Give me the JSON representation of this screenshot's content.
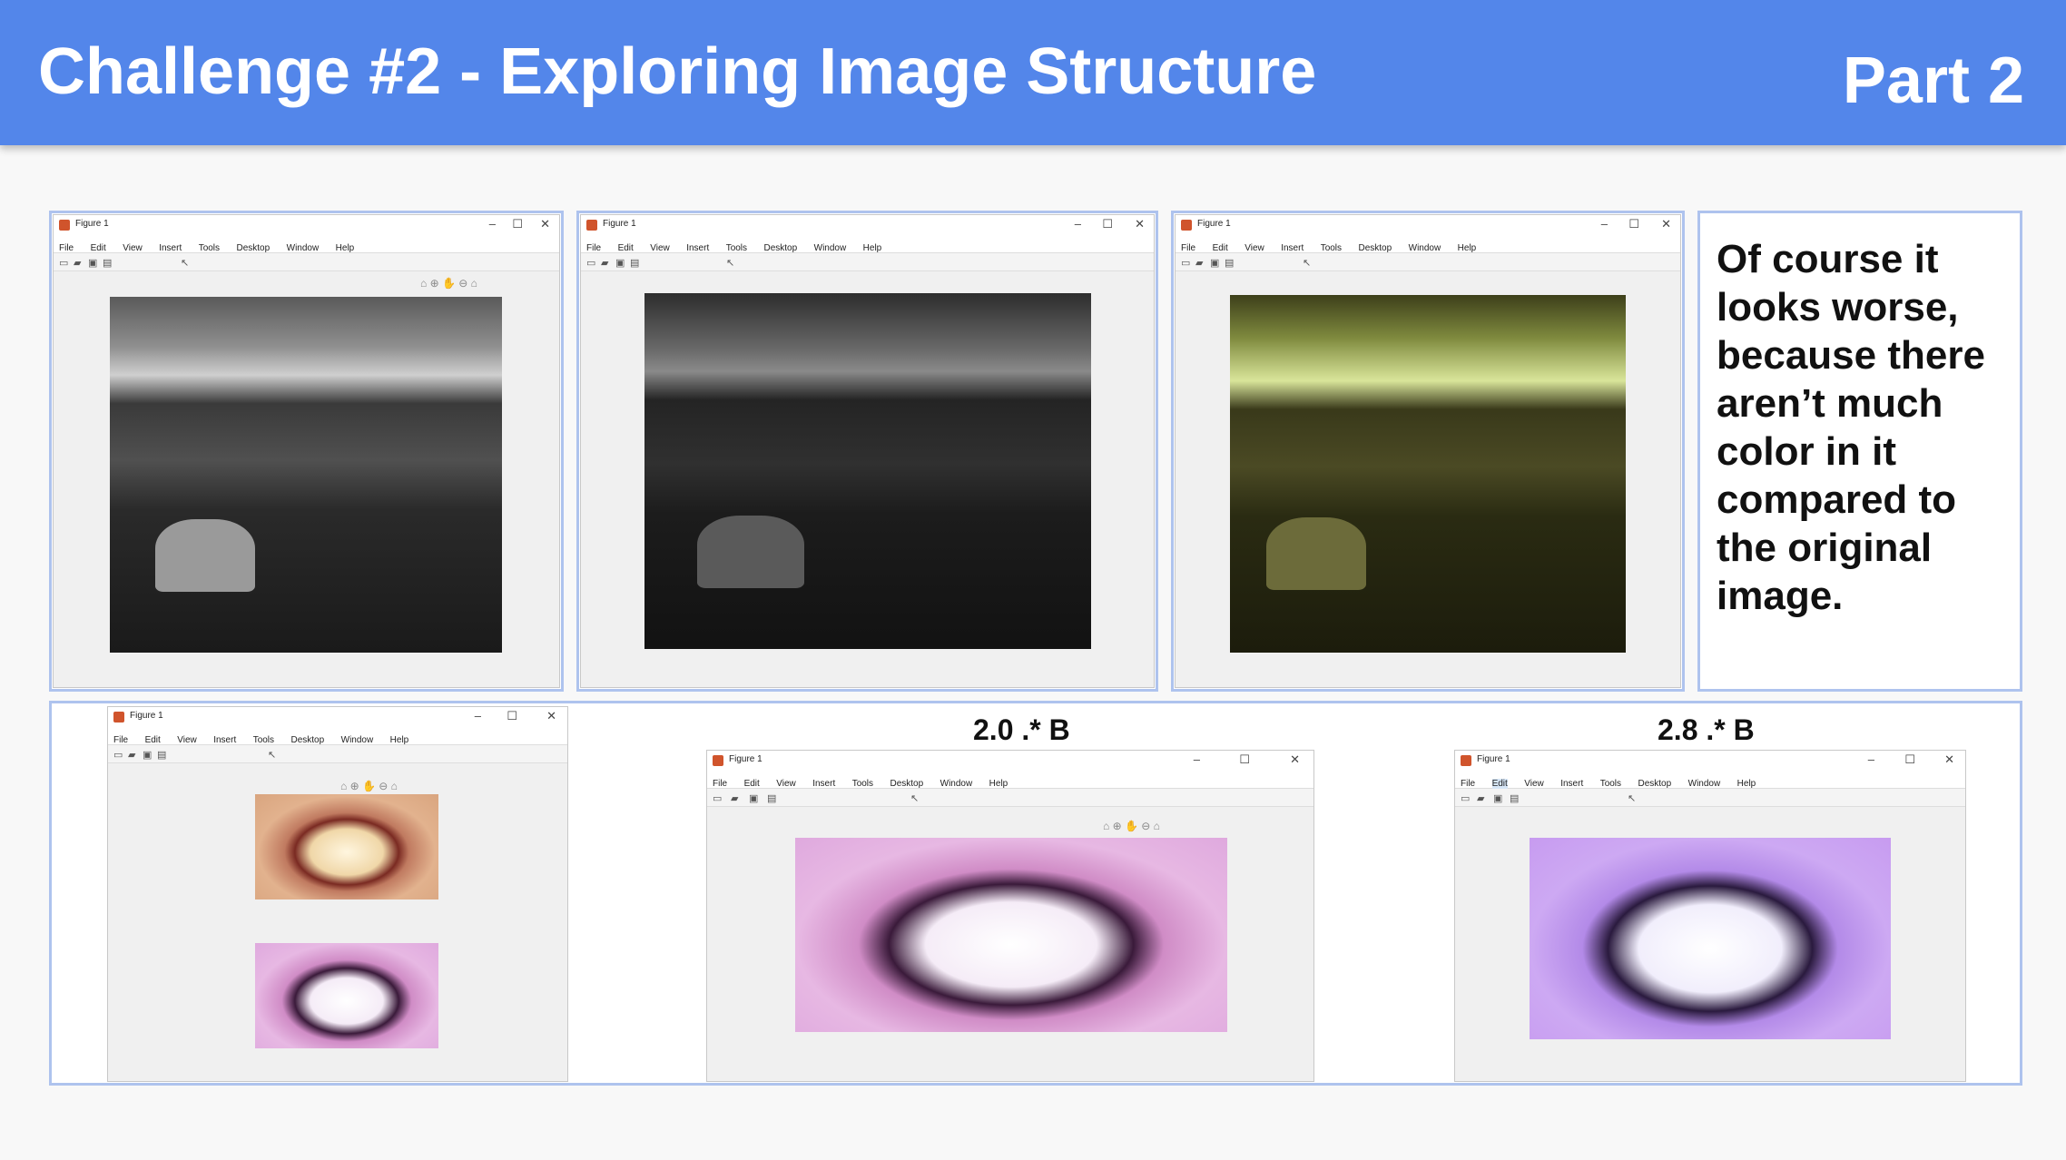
{
  "header": {
    "title": "Challenge #2 - Exploring Image Structure",
    "part": "Part 2"
  },
  "figure_window": {
    "title": "Figure 1",
    "menu": [
      "File",
      "Edit",
      "View",
      "Insert",
      "Tools",
      "Desktop",
      "Window",
      "Help"
    ],
    "minimize_glyph": "–",
    "maximize_glyph": "☐",
    "close_glyph": "✕"
  },
  "note": {
    "text": "Of course it looks worse, because there aren’t much color in it compared to the original image."
  },
  "captions": {
    "middle": "2.0 .* B",
    "right": "2.8 .* B"
  },
  "colors": {
    "header_bg": "#5386ea",
    "panel_border": "#aec3ee"
  }
}
